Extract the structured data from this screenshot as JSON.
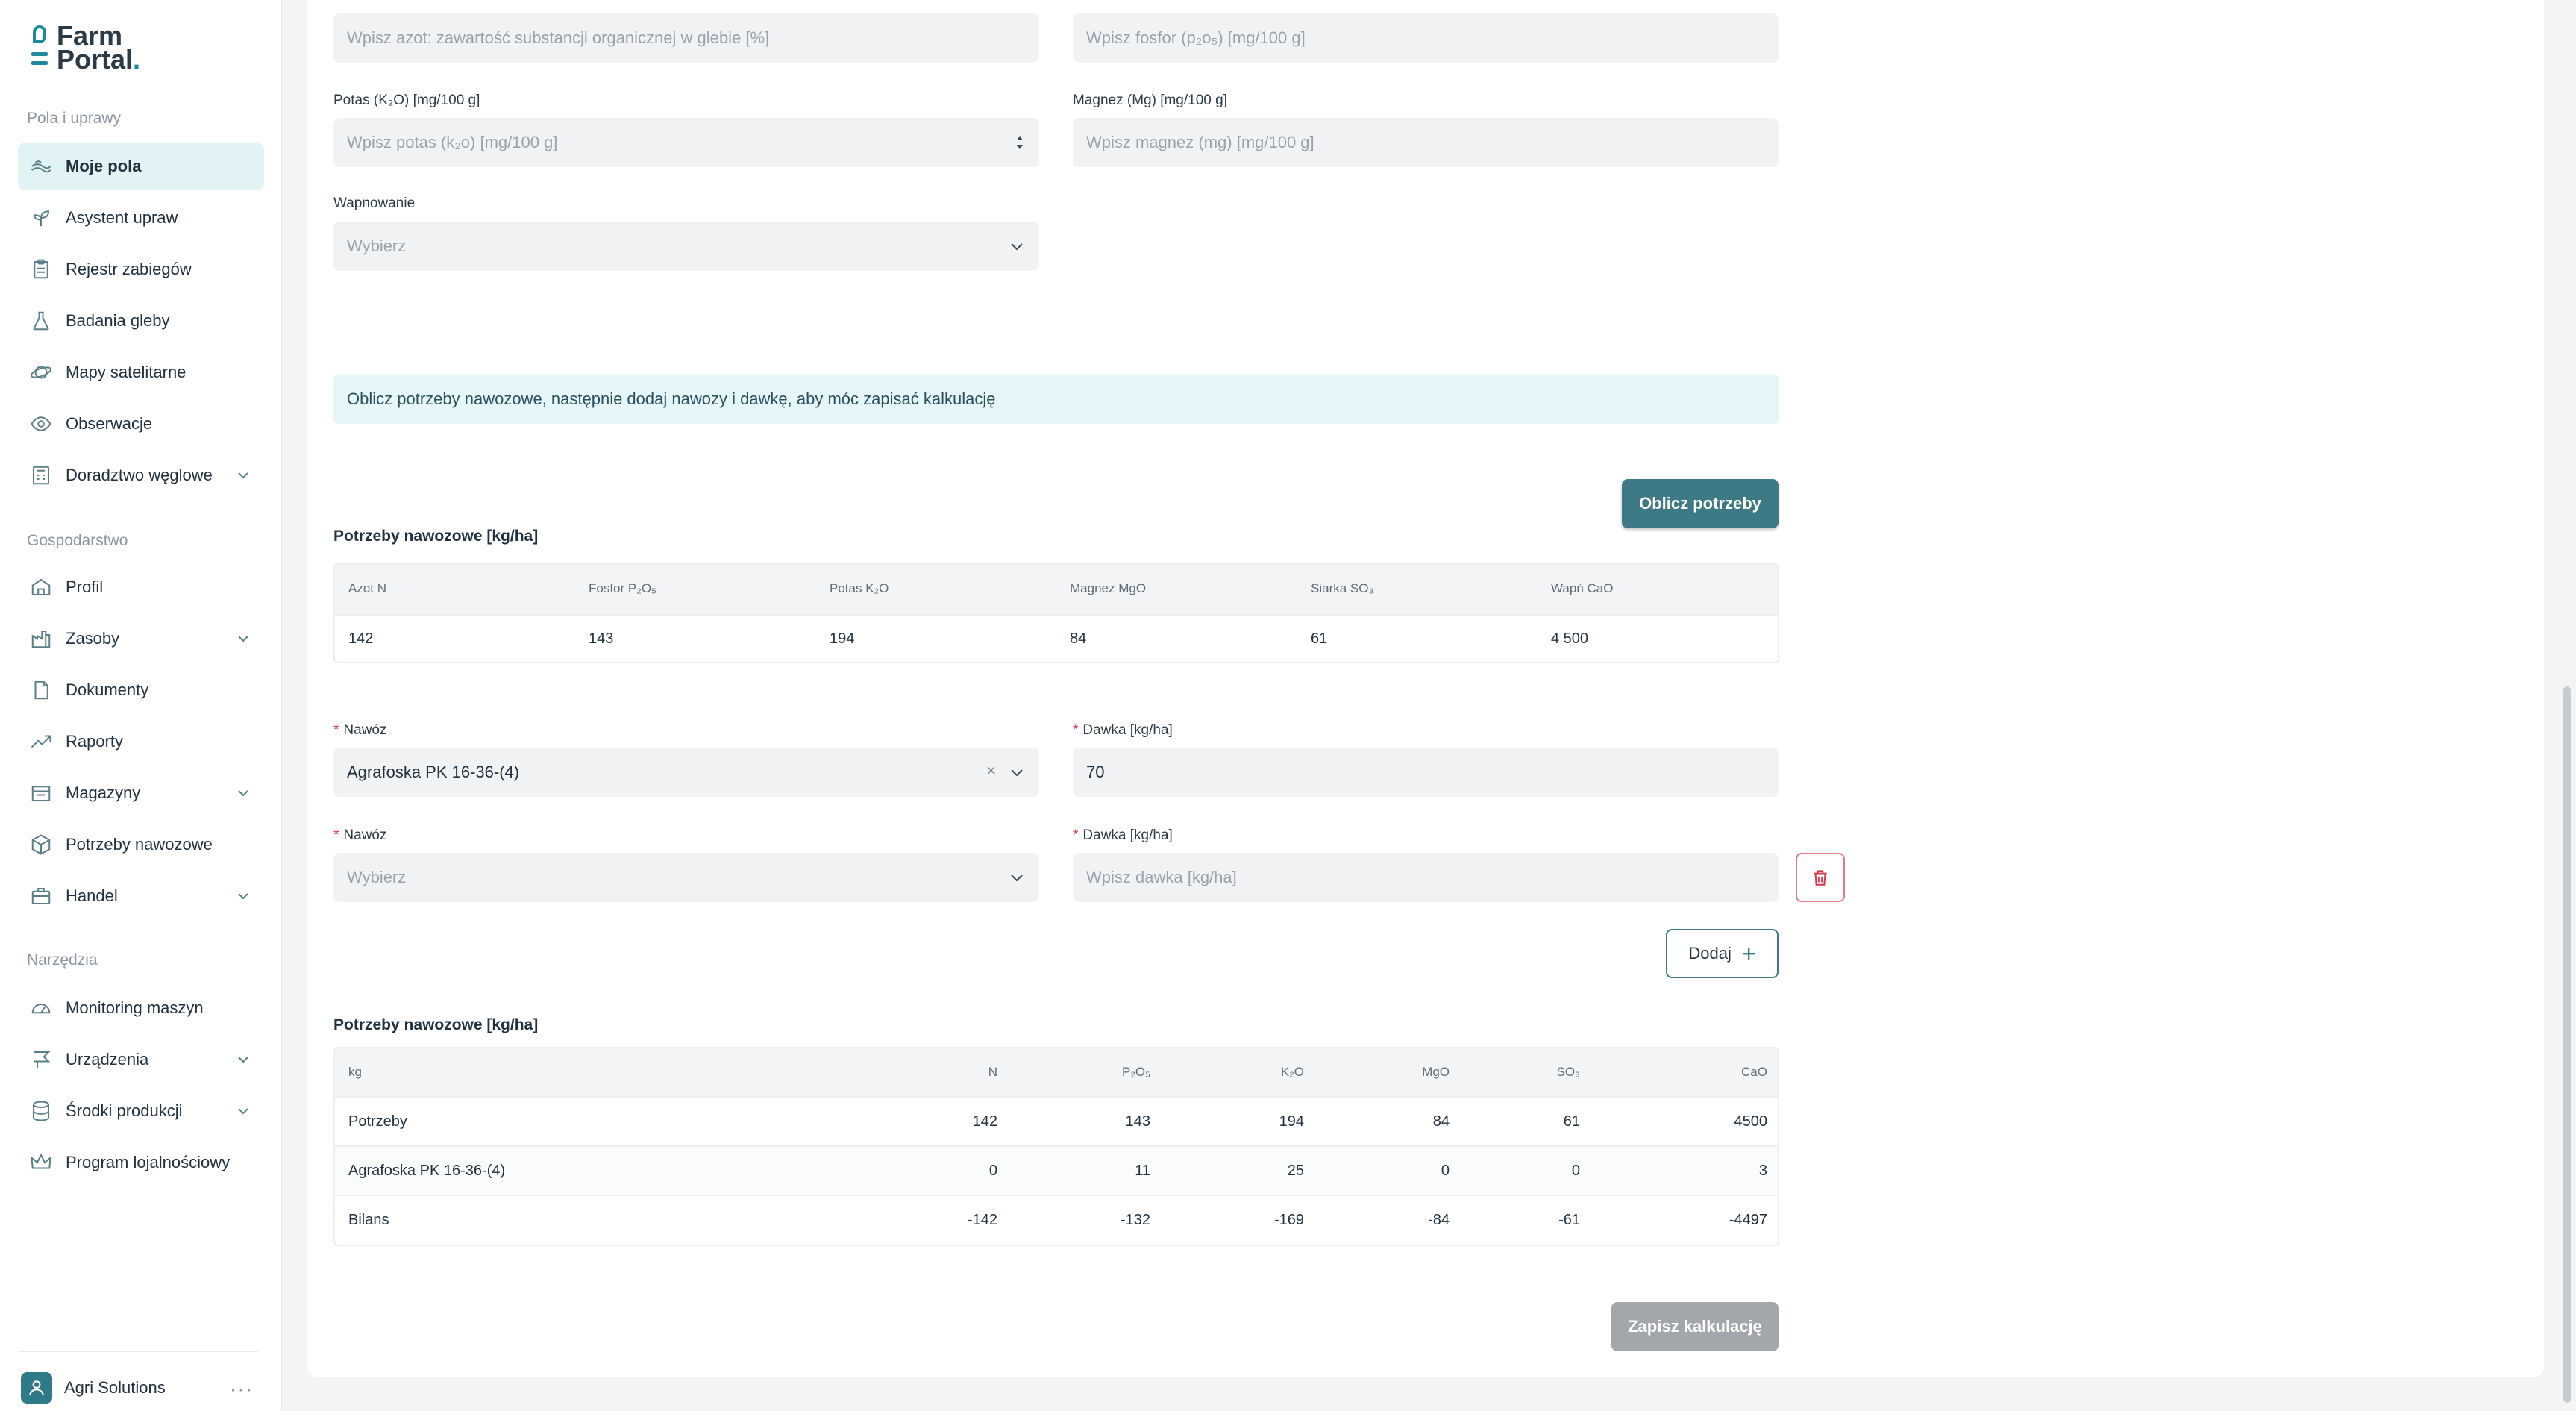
{
  "app": {
    "logo_line1": "Farm",
    "logo_line2": "Portal",
    "logo_dot": "."
  },
  "sidebar": {
    "section1": "Pola i uprawy",
    "section2": "Gospodarstwo",
    "section3": "Narzędzia",
    "items": [
      {
        "label": "Moje pola",
        "icon": "fields-icon"
      },
      {
        "label": "Asystent upraw",
        "icon": "sprout-icon"
      },
      {
        "label": "Rejestr zabiegów",
        "icon": "clipboard-icon"
      },
      {
        "label": "Badania gleby",
        "icon": "flask-icon"
      },
      {
        "label": "Mapy satelitarne",
        "icon": "satellite-icon"
      },
      {
        "label": "Obserwacje",
        "icon": "eye-icon"
      },
      {
        "label": "Doradztwo węglowe",
        "icon": "calculator-icon"
      },
      {
        "label": "Profil",
        "icon": "farm-icon"
      },
      {
        "label": "Zasoby",
        "icon": "factory-icon"
      },
      {
        "label": "Dokumenty",
        "icon": "document-icon"
      },
      {
        "label": "Raporty",
        "icon": "trend-icon"
      },
      {
        "label": "Magazyny",
        "icon": "warehouse-icon"
      },
      {
        "label": "Potrzeby nawozowe",
        "icon": "fertilizer-icon"
      },
      {
        "label": "Handel",
        "icon": "briefcase-icon"
      },
      {
        "label": "Monitoring maszyn",
        "icon": "gauge-icon"
      },
      {
        "label": "Urządzenia",
        "icon": "flag-icon"
      },
      {
        "label": "Środki produkcji",
        "icon": "database-icon"
      },
      {
        "label": "Program lojalnościowy",
        "icon": "crown-icon"
      }
    ],
    "user": "Agri Solutions"
  },
  "form": {
    "azot_placeholder": "Wpisz azot: zawartość substancji organicznej w glebie [%]",
    "fosfor_placeholder": "Wpisz fosfor (p₂o₅) [mg/100 g]",
    "potas_label": "Potas (K₂O) [mg/100 g]",
    "potas_placeholder": "Wpisz potas (k₂o) [mg/100 g]",
    "magnez_label": "Magnez (Mg) [mg/100 g]",
    "magnez_placeholder": "Wpisz magnez (mg) [mg/100 g]",
    "wapnowanie_label": "Wapnowanie",
    "wapnowanie_placeholder": "Wybierz"
  },
  "info_text": "Oblicz potrzeby nawozowe, następnie dodaj nawozy i dawkę, aby móc zapisać kalkulację",
  "calc_button": "Oblicz potrzeby",
  "needs": {
    "heading": "Potrzeby nawozowe [kg/ha]",
    "headers": [
      "Azot N",
      "Fosfor P₂O₅",
      "Potas K₂O",
      "Magnez MgO",
      "Siarka SO₃",
      "Wapń CaO"
    ],
    "values": [
      "142",
      "143",
      "194",
      "84",
      "61",
      "4 500"
    ]
  },
  "fertilizers": {
    "required_mark": "*",
    "nawoz_label": "Nawóz",
    "dawka_label": "Dawka [kg/ha]",
    "row1_nawoz": "Agrafoska PK 16-36-(4)",
    "row1_dawka": "70",
    "row2_nawoz_placeholder": "Wybierz",
    "row2_dawka_placeholder": "Wpisz dawka [kg/ha]",
    "clear_symbol": "×"
  },
  "add_button": "Dodaj",
  "balance": {
    "heading": "Potrzeby nawozowe [kg/ha]",
    "headers": [
      "kg",
      "N",
      "P₂O₅",
      "K₂O",
      "MgO",
      "SO₃",
      "CaO"
    ],
    "rows": [
      {
        "label": "Potrzeby",
        "values": [
          "142",
          "143",
          "194",
          "84",
          "61",
          "4500"
        ]
      },
      {
        "label": "Agrafoska PK 16-36-(4)",
        "values": [
          "0",
          "11",
          "25",
          "0",
          "0",
          "3"
        ]
      },
      {
        "label": "Bilans",
        "values": [
          "-142",
          "-132",
          "-169",
          "-84",
          "-61",
          "-4497"
        ]
      }
    ]
  },
  "save_button": "Zapisz kalkulację",
  "colors": {
    "accent": "#3e7a86",
    "active_bg": "#e2f3f5",
    "info_bg": "#e6f6f8",
    "danger": "#d9394a",
    "disabled": "#a3a7ab"
  }
}
